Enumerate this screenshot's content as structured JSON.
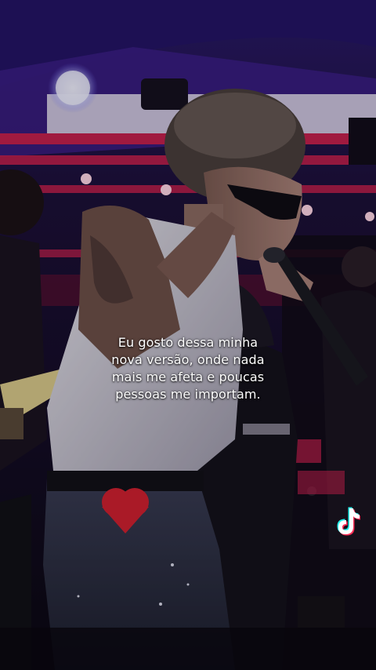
{
  "caption": {
    "lines": [
      "Eu gosto dessa minha",
      "nova versão, onde nada",
      "mais me afeta e poucas",
      "pessoas me importam."
    ]
  },
  "watermark": {
    "icon": "tiktok-icon"
  },
  "colors": {
    "stage_magenta": "#c4204e",
    "stage_purple": "#3d1f8a",
    "caption_text": "#ffffff"
  }
}
